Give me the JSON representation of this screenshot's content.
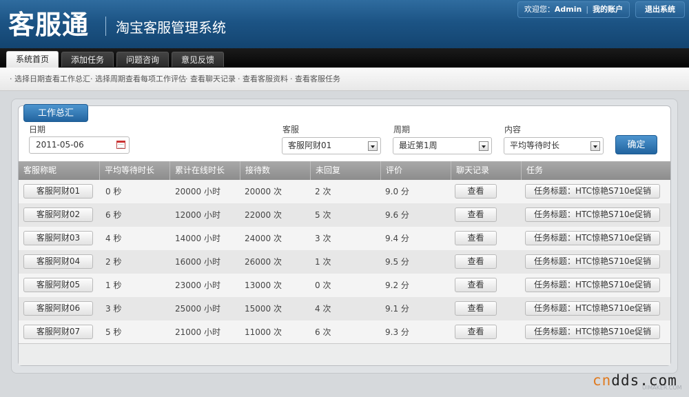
{
  "header": {
    "logo": "客服通",
    "subtitle": "淘宝客服管理系统",
    "welcome": "欢迎您：",
    "username": "Admin",
    "my_account": "我的账户",
    "logout": "退出系统"
  },
  "nav": {
    "tabs": [
      {
        "label": "系统首页",
        "active": true
      },
      {
        "label": "添加任务",
        "active": false
      },
      {
        "label": "问题咨询",
        "active": false
      },
      {
        "label": "意见反馈",
        "active": false
      }
    ],
    "sublinks": [
      "· 选择日期查看工作总汇",
      "· 选择周期查看每项工作评估",
      "· 查看聊天记录",
      "· 查看客服资料",
      "· 查看客服任务"
    ]
  },
  "panel": {
    "section_title": "工作总汇",
    "filters": {
      "date_label": "日期",
      "date_value": "2011-05-06",
      "agent_label": "客服",
      "agent_value": "客服阿财01",
      "period_label": "周期",
      "period_value": "最近第1周",
      "content_label": "内容",
      "content_value": "平均等待时长",
      "confirm": "确定"
    },
    "columns": [
      "客服称昵",
      "平均等待时长",
      "累计在线时长",
      "接待数",
      "未回复",
      "评价",
      "聊天记录",
      "任务"
    ],
    "view_label": "查看",
    "rows": [
      {
        "name": "客服阿财01",
        "wait": "0 秒",
        "online": "20000 小时",
        "received": "20000 次",
        "unreplied": "2 次",
        "rating": "9.0 分",
        "task": "任务标题：HTC惊艳S710e促销"
      },
      {
        "name": "客服阿财02",
        "wait": "6 秒",
        "online": "12000 小时",
        "received": "22000 次",
        "unreplied": "5 次",
        "rating": "9.6 分",
        "task": "任务标题：HTC惊艳S710e促销"
      },
      {
        "name": "客服阿财03",
        "wait": "4 秒",
        "online": "14000 小时",
        "received": "24000 次",
        "unreplied": "3 次",
        "rating": "9.4 分",
        "task": "任务标题：HTC惊艳S710e促销"
      },
      {
        "name": "客服阿财04",
        "wait": "2 秒",
        "online": "16000 小时",
        "received": "26000 次",
        "unreplied": "1 次",
        "rating": "9.5 分",
        "task": "任务标题：HTC惊艳S710e促销"
      },
      {
        "name": "客服阿财05",
        "wait": "1 秒",
        "online": "23000 小时",
        "received": "13000 次",
        "unreplied": "0 次",
        "rating": "9.2 分",
        "task": "任务标题：HTC惊艳S710e促销"
      },
      {
        "name": "客服阿财06",
        "wait": "3 秒",
        "online": "25000 小时",
        "received": "15000 次",
        "unreplied": "4 次",
        "rating": "9.1 分",
        "task": "任务标题：HTC惊艳S710e促销"
      },
      {
        "name": "客服阿财07",
        "wait": "5 秒",
        "online": "21000 小时",
        "received": "11000 次",
        "unreplied": "6 次",
        "rating": "9.3 分",
        "task": "任务标题：HTC惊艳S710e促销"
      }
    ]
  },
  "watermark": {
    "brand_a": "cn",
    "brand_b": "dds.com",
    "sub": "UIMAKER.COM"
  },
  "colors": {
    "header_blue": "#1c5485",
    "button_blue": "#2a6eaa",
    "watermark_orange": "#e07a1f"
  }
}
